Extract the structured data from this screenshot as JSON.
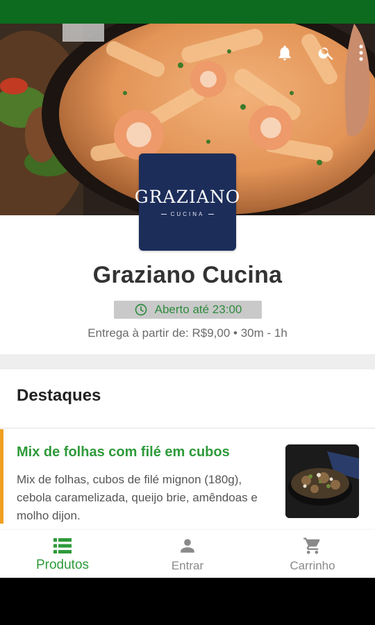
{
  "restaurant": {
    "name": "Graziano Cucina",
    "logo_name": "GRAZIANO",
    "logo_sub": "CUCINA",
    "open_status": "Aberto até 23:00",
    "delivery_info": "Entrega à partir de: R$9,00 • 30m - 1h"
  },
  "header": {
    "actions": [
      "notifications",
      "search",
      "more"
    ]
  },
  "featured": {
    "title": "Destaques",
    "items": [
      {
        "name": "Mix de folhas com filé em cubos",
        "description": "Mix de folhas, cubos de filé mignon (180g), cebola caramelizada, queijo brie, amêndoas e molho dijon."
      }
    ]
  },
  "bottom_nav": {
    "items": [
      {
        "label": "Produtos",
        "icon": "list-icon",
        "active": true
      },
      {
        "label": "Entrar",
        "icon": "person-icon",
        "active": false
      },
      {
        "label": "Carrinho",
        "icon": "cart-icon",
        "active": false
      }
    ]
  },
  "colors": {
    "status_bar": "#0c6b1e",
    "accent_green": "#2e9a3a",
    "logo_bg": "#1c2d5a",
    "highlight_orange": "#f0a020"
  }
}
